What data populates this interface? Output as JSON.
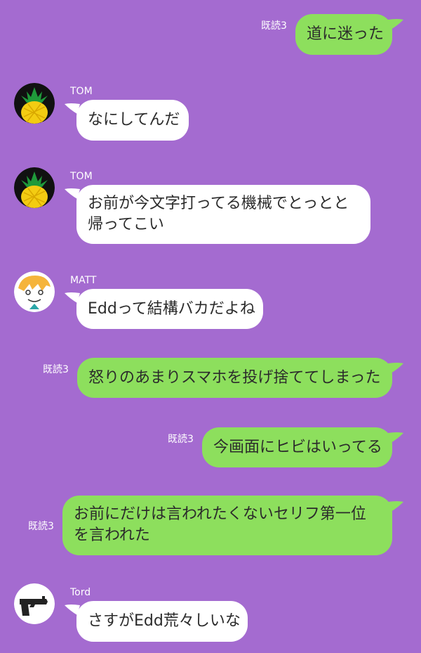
{
  "chat": {
    "messages": [
      {
        "direction": "out",
        "text": "道に迷った",
        "read": "既読3"
      },
      {
        "direction": "in",
        "sender": "TOM",
        "avatar": "pineapple-avatar",
        "text": "なにしてんだ"
      },
      {
        "direction": "in",
        "sender": "TOM",
        "avatar": "pineapple-avatar",
        "text": "お前が今文字打ってる機械でとっとと帰ってこい"
      },
      {
        "direction": "in",
        "sender": "MATT",
        "avatar": "matt-face-avatar",
        "text": "Eddって結構バカだよね"
      },
      {
        "direction": "out",
        "text": "怒りのあまりスマホを投げ捨ててしまった",
        "read": "既読3"
      },
      {
        "direction": "out",
        "text": "今画面にヒビはいってる",
        "read": "既読3"
      },
      {
        "direction": "out",
        "text": "お前にだけは言われたくないセリフ第一位を言われた",
        "read": "既読3"
      },
      {
        "direction": "in",
        "sender": "Tord",
        "avatar": "pistol-avatar",
        "text": "さすがEdd荒々しいな"
      }
    ]
  },
  "colors": {
    "background": "#a46bd0",
    "incoming_bubble": "#ffffff",
    "outgoing_bubble": "#8ddf5d",
    "meta_text": "#ffffff"
  }
}
